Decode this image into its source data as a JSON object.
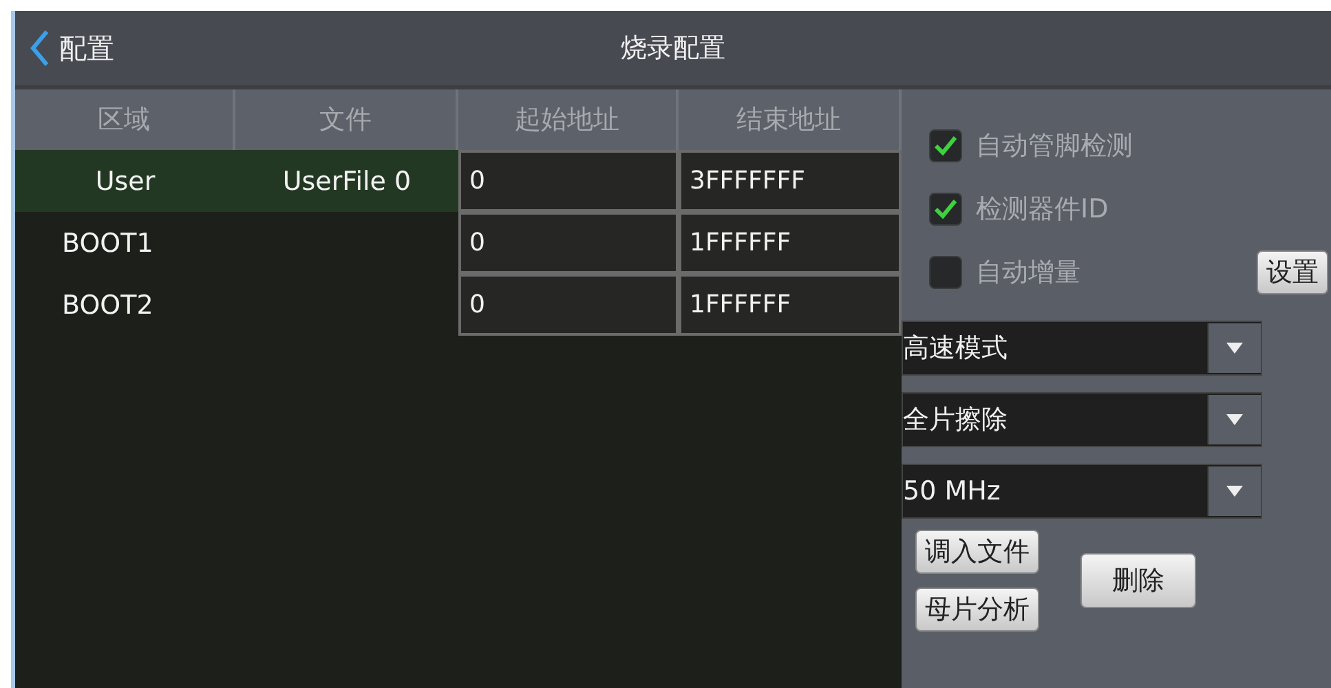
{
  "header": {
    "back_label": "配置",
    "title": "烧录配置"
  },
  "table": {
    "columns": [
      "区域",
      "文件",
      "起始地址",
      "结束地址"
    ],
    "rows": [
      {
        "region": "User",
        "file": "UserFile 0",
        "start": "0",
        "end": "3FFFFFFF",
        "selected": true
      },
      {
        "region": "BOOT1",
        "start": "0",
        "end": "1FFFFFF",
        "selected": false
      },
      {
        "region": "BOOT2",
        "start": "0",
        "end": "1FFFFFF",
        "selected": false
      }
    ]
  },
  "options": [
    {
      "label": "自动管脚检测",
      "checked": true
    },
    {
      "label": "检测器件ID",
      "checked": true
    },
    {
      "label": "自动增量",
      "checked": false,
      "button": "设置"
    }
  ],
  "dropdowns": [
    {
      "value": "高速模式"
    },
    {
      "value": "全片擦除"
    },
    {
      "value": "50 MHz"
    }
  ],
  "buttons": {
    "load_file": "调入文件",
    "delete": "删除",
    "analyze": "母片分析"
  }
}
